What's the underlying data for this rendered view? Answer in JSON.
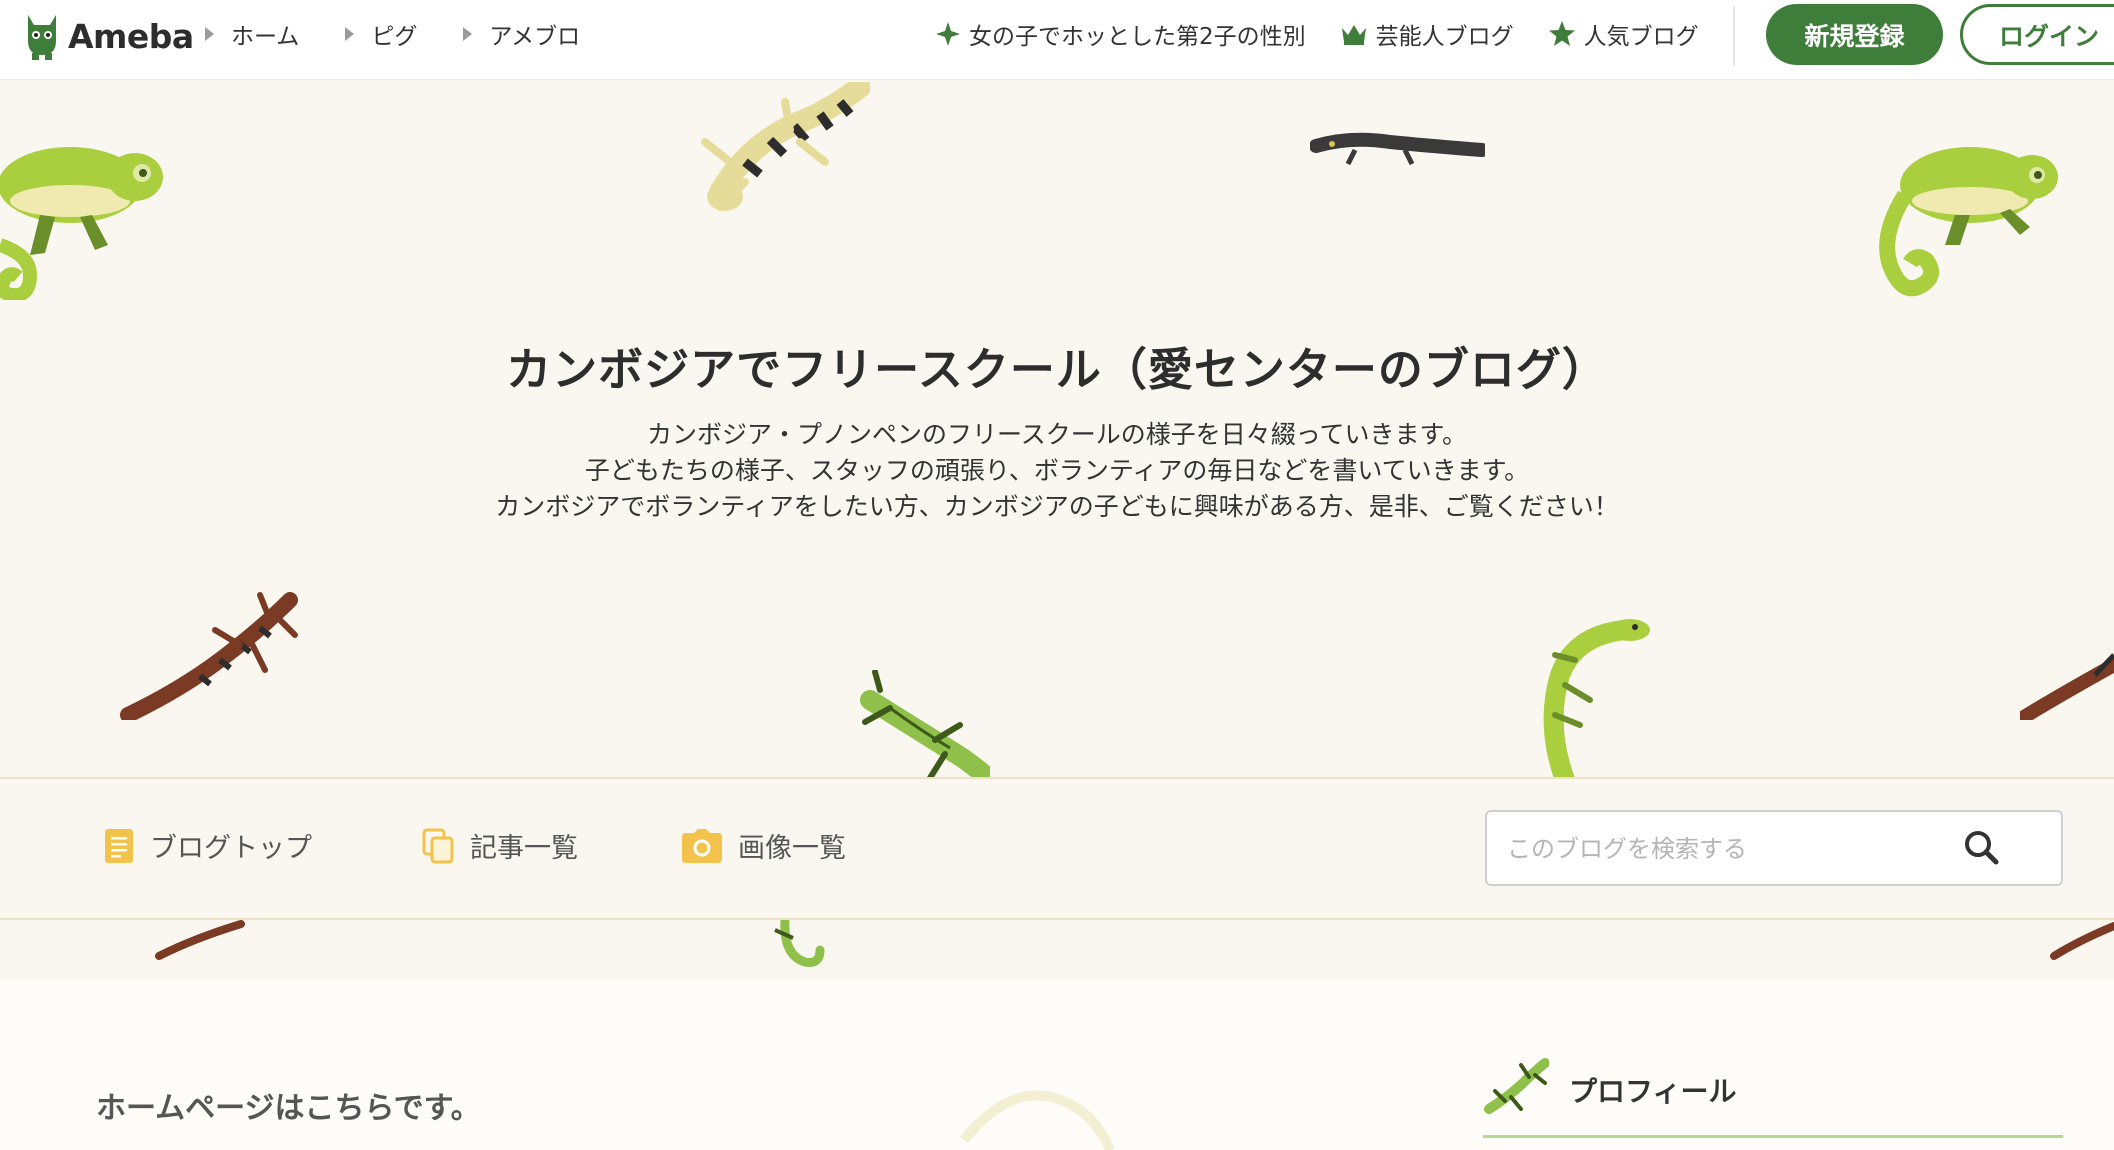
{
  "topbar": {
    "logo_text": "Ameba",
    "breadcrumbs": [
      "ホーム",
      "ピグ",
      "アメブロ"
    ],
    "links": [
      {
        "label": "女の子でホッとした第2子の性別",
        "icon": "sparkle-icon"
      },
      {
        "label": "芸能人ブログ",
        "icon": "crown-icon"
      },
      {
        "label": "人気ブログ",
        "icon": "star-icon"
      }
    ],
    "signup_label": "新規登録",
    "login_label": "ログイン"
  },
  "blog": {
    "title": "カンボジアでフリースクール（愛センターのブログ）",
    "description": [
      "カンボジア・プノンペンのフリースクールの様子を日々綴っていきます。",
      "子どもたちの様子、スタッフの頑張り、ボランティアの毎日などを書いていきます。",
      "カンボジアでボランティアをしたい方、カンボジアの子どもに興味がある方、是非、ご覧ください！"
    ]
  },
  "blog_nav": {
    "items": [
      {
        "label": "ブログトップ",
        "icon": "document-icon"
      },
      {
        "label": "記事一覧",
        "icon": "copy-icon"
      },
      {
        "label": "画像一覧",
        "icon": "camera-icon"
      }
    ],
    "search_placeholder": "このブログを検索する"
  },
  "main": {
    "post_title": "ホームページはこちらです。"
  },
  "sidebar": {
    "profile_label": "プロフィール"
  },
  "colors": {
    "brand_green": "#3e7d3a",
    "header_bg": "#f9f7ef",
    "accent_yellow": "#f2c24b",
    "lizard_green": "#a9cf3f"
  }
}
